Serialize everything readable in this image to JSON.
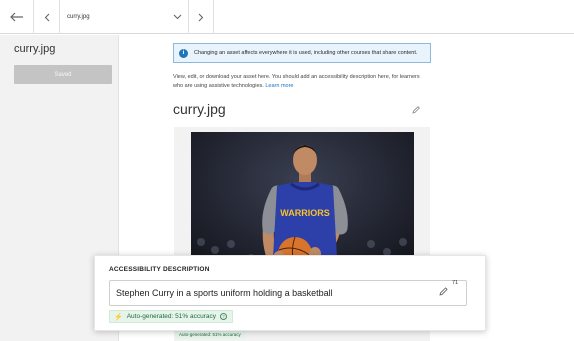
{
  "topbar": {
    "filename": "curry.jpg"
  },
  "left_panel": {
    "title": "curry.jpg",
    "saved_label": "Saved"
  },
  "main": {
    "info_text": "Changing an asset affects everywhere it is used, including other courses that share content.",
    "description_line1": "View, edit, or download your asset here. You should add an accessibility description here, for learners",
    "description_line2": "who are using assistive technologies.",
    "learn_more": "Learn more",
    "asset_title": "curry.jpg"
  },
  "accessibility_card": {
    "heading": "ACCESSIBILITY DESCRIPTION",
    "value": "Stephen Curry in a sports uniform holding a basketball",
    "char_count": "71",
    "badge_text": "Auto-generated: 51% accuracy",
    "badge_help": "?"
  },
  "behind_badge": {
    "text": "Auto-generated: 51% accuracy"
  },
  "photo": {
    "jersey_text": "WARRIORS"
  },
  "colors": {
    "accent": "#1f73b7",
    "info_bg": "#e9f3fb",
    "badge_bg": "#e6f4ea",
    "badge_text": "#1d6b3a",
    "saved_button": "#c4c4c4"
  }
}
